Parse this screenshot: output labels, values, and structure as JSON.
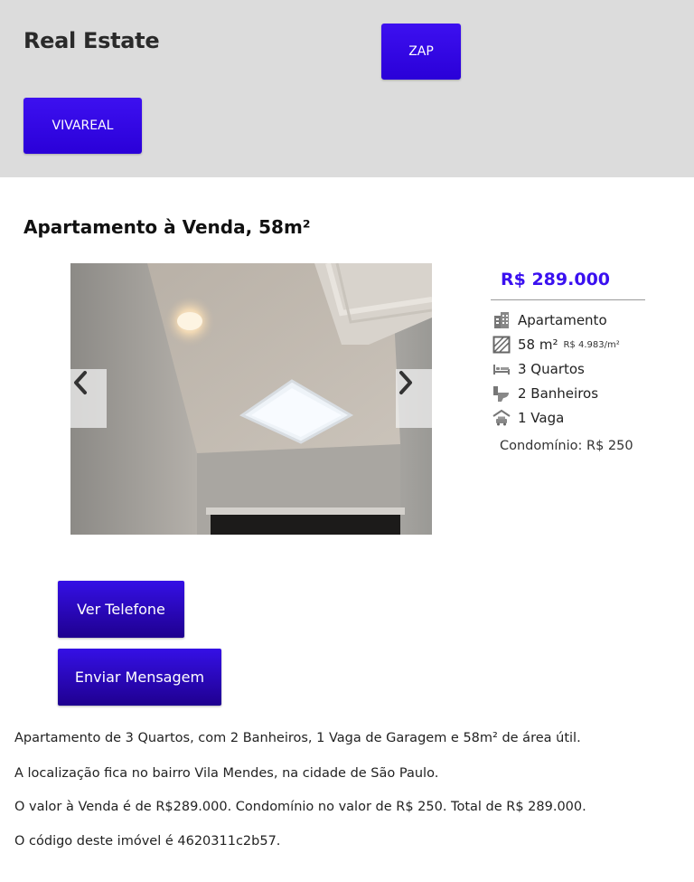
{
  "header": {
    "brand": "Real Estate",
    "zap_label": "ZAP",
    "vivareal_label": "VIVAREAL"
  },
  "listing": {
    "title": "Apartamento à Venda, 58m²",
    "price": "R$ 289.000",
    "features": {
      "type": "Apartamento",
      "area": "58 m²",
      "area_price": "R$ 4.983/m²",
      "rooms": "3 Quartos",
      "bathrooms": "2 Banheiros",
      "parking": "1 Vaga"
    },
    "condo": "Condomínio: R$ 250"
  },
  "actions": {
    "phone_label": "Ver Telefone",
    "message_label": "Enviar Mensagem"
  },
  "description": [
    "Apartamento de 3 Quartos, com 2 Banheiros, 1 Vaga de Garagem e 58m² de área útil.",
    "A localização fica no bairro Vila Mendes, na cidade de São Paulo.",
    "O valor à Venda é de R$289.000. Condomínio no valor de R$ 250. Total de R$ 289.000.",
    "O código deste imóvel é 4620311c2b57."
  ],
  "icons": {
    "type": "building-icon",
    "area": "area-icon",
    "rooms": "bed-icon",
    "bathrooms": "toilet-icon",
    "parking": "garage-icon",
    "prev": "chevron-left-icon",
    "next": "chevron-right-icon"
  },
  "colors": {
    "accent": "#3a10f0",
    "header_bg": "#dcdcdc"
  }
}
